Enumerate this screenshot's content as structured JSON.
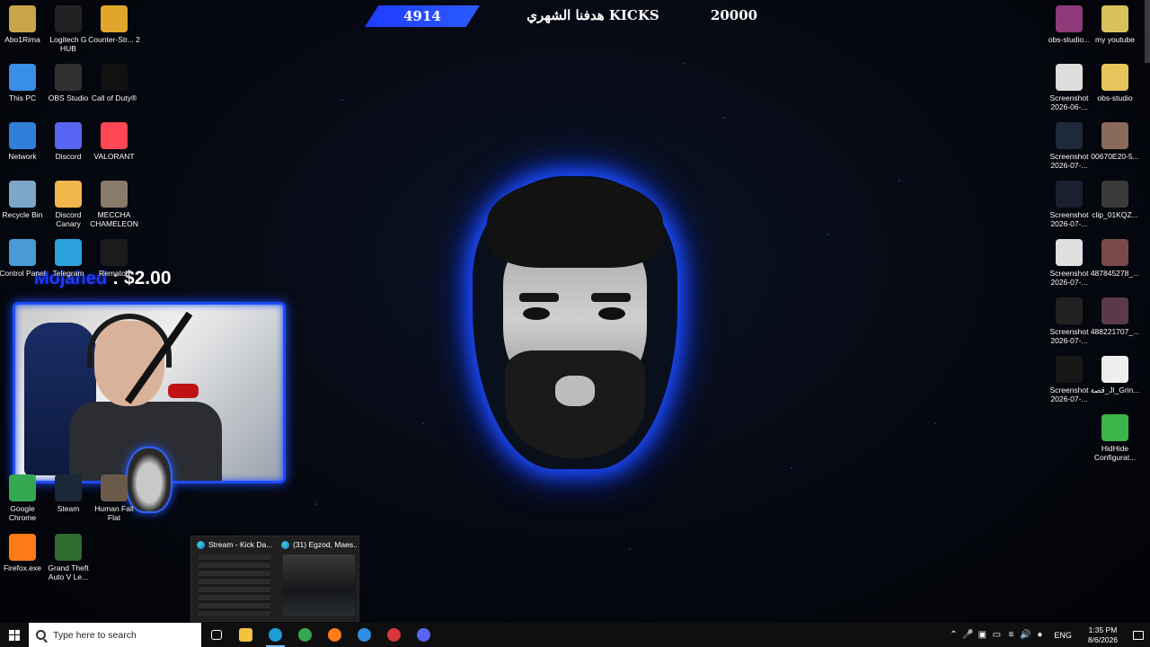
{
  "goal": {
    "count": "4914",
    "title": "هدفنا الشهري KICKS",
    "target": "20000"
  },
  "donation": {
    "name": "Mojahed",
    "amount": ": $2.00"
  },
  "desktop_left": [
    {
      "label": "Abo1Rima",
      "icon": "folder-user-icon",
      "color": "#c9a54a"
    },
    {
      "label": "Logitech G HUB",
      "icon": "logitech-g-icon",
      "color": "#222222"
    },
    {
      "label": "Counter-Str... 2",
      "icon": "counter-strike-icon",
      "color": "#e0a52a"
    },
    {
      "label": "This PC",
      "icon": "this-pc-icon",
      "color": "#3a8ee6"
    },
    {
      "label": "OBS Studio",
      "icon": "obs-studio-icon",
      "color": "#303030"
    },
    {
      "label": "Call of Duty®",
      "icon": "call-of-duty-icon",
      "color": "#111111"
    },
    {
      "label": "Network",
      "icon": "network-icon",
      "color": "#2f7fd6"
    },
    {
      "label": "Discord",
      "icon": "discord-icon",
      "color": "#5865f2"
    },
    {
      "label": "VALORANT",
      "icon": "valorant-icon",
      "color": "#ff4655"
    },
    {
      "label": "Recycle Bin",
      "icon": "recycle-bin-icon",
      "color": "#7da7c9"
    },
    {
      "label": "Discord Canary",
      "icon": "discord-canary-icon",
      "color": "#f1b74a"
    },
    {
      "label": "MECCHA CHAMELEON",
      "icon": "meccha-chameleon-icon",
      "color": "#8a7a6a"
    },
    {
      "label": "Control Panel",
      "icon": "control-panel-icon",
      "color": "#4a9ad6"
    },
    {
      "label": "Telegram",
      "icon": "telegram-icon",
      "color": "#2aa1da"
    },
    {
      "label": "Rematch",
      "icon": "rematch-icon",
      "color": "#1b1b1b"
    },
    {
      "label": "Google Chrome",
      "icon": "chrome-icon",
      "color": "#34a853"
    },
    {
      "label": "Steam",
      "icon": "steam-icon",
      "color": "#1b2838"
    },
    {
      "label": "Human Fall Flat",
      "icon": "human-fall-flat-icon",
      "color": "#6a5a4a"
    },
    {
      "label": "Firefox.exe",
      "icon": "firefox-icon",
      "color": "#ff7a18"
    },
    {
      "label": "Grand Theft Auto V Le...",
      "icon": "gta-v-icon",
      "color": "#2e6b2e"
    }
  ],
  "desktop_right": [
    {
      "label": "obs-studio...",
      "icon": "winrar-icon",
      "color": "#8e3b7a"
    },
    {
      "label": "my youtube",
      "icon": "archive-icon",
      "color": "#d8c15a"
    },
    {
      "label": "Screenshot 2026-06-...",
      "icon": "screenshot-icon",
      "color": "#dddddd"
    },
    {
      "label": "obs-studio",
      "icon": "folder-icon",
      "color": "#e8c55a"
    },
    {
      "label": "Screenshot 2026-07-...",
      "icon": "screenshot-icon",
      "color": "#1f2a3a"
    },
    {
      "label": "00670E20-5...",
      "icon": "image-icon",
      "color": "#8a6a5a"
    },
    {
      "label": "Screenshot 2026-07-...",
      "icon": "screenshot-icon",
      "color": "#1a2030"
    },
    {
      "label": "clip_01KQZ...",
      "icon": "video-clip-icon",
      "color": "#3a3a3a"
    },
    {
      "label": "Screenshot 2026-07-...",
      "icon": "screenshot-icon",
      "color": "#e0e0e0"
    },
    {
      "label": "487845278_...",
      "icon": "image-icon",
      "color": "#7a4a4a"
    },
    {
      "label": "Screenshot 2026-07-...",
      "icon": "screenshot-icon",
      "color": "#222222"
    },
    {
      "label": "488221707_...",
      "icon": "image-icon",
      "color": "#5a3a4a"
    },
    {
      "label": "Screenshot 2026-07-...",
      "icon": "screenshot-icon",
      "color": "#181818"
    },
    {
      "label": "قصة_Jl_Grin...",
      "icon": "video-play-icon",
      "color": "#eeeeee"
    },
    {
      "label": "HidHide Configurat...",
      "icon": "hidhide-icon",
      "color": "#3bb54a"
    }
  ],
  "preview": [
    {
      "title": "Stream - Kick Da..."
    },
    {
      "title": "(31) Egzod, Maes..."
    }
  ],
  "taskbar": {
    "search_placeholder": "Type here to search",
    "apps": [
      {
        "name": "task-view-icon",
        "color": "#222222"
      },
      {
        "name": "file-explorer-icon",
        "color": "#f3c23e"
      },
      {
        "name": "edge-icon",
        "color": "#1f9bd6",
        "active": true
      },
      {
        "name": "chrome-icon",
        "color": "#34a853"
      },
      {
        "name": "firefox-icon",
        "color": "#ff7a18"
      },
      {
        "name": "app-blue-icon",
        "color": "#2f8fe6"
      },
      {
        "name": "app-red-icon",
        "color": "#d9363e"
      },
      {
        "name": "discord-icon",
        "color": "#5865f2"
      }
    ],
    "lang": "ENG",
    "time": "1:35 PM",
    "date": "8/6/2026"
  }
}
